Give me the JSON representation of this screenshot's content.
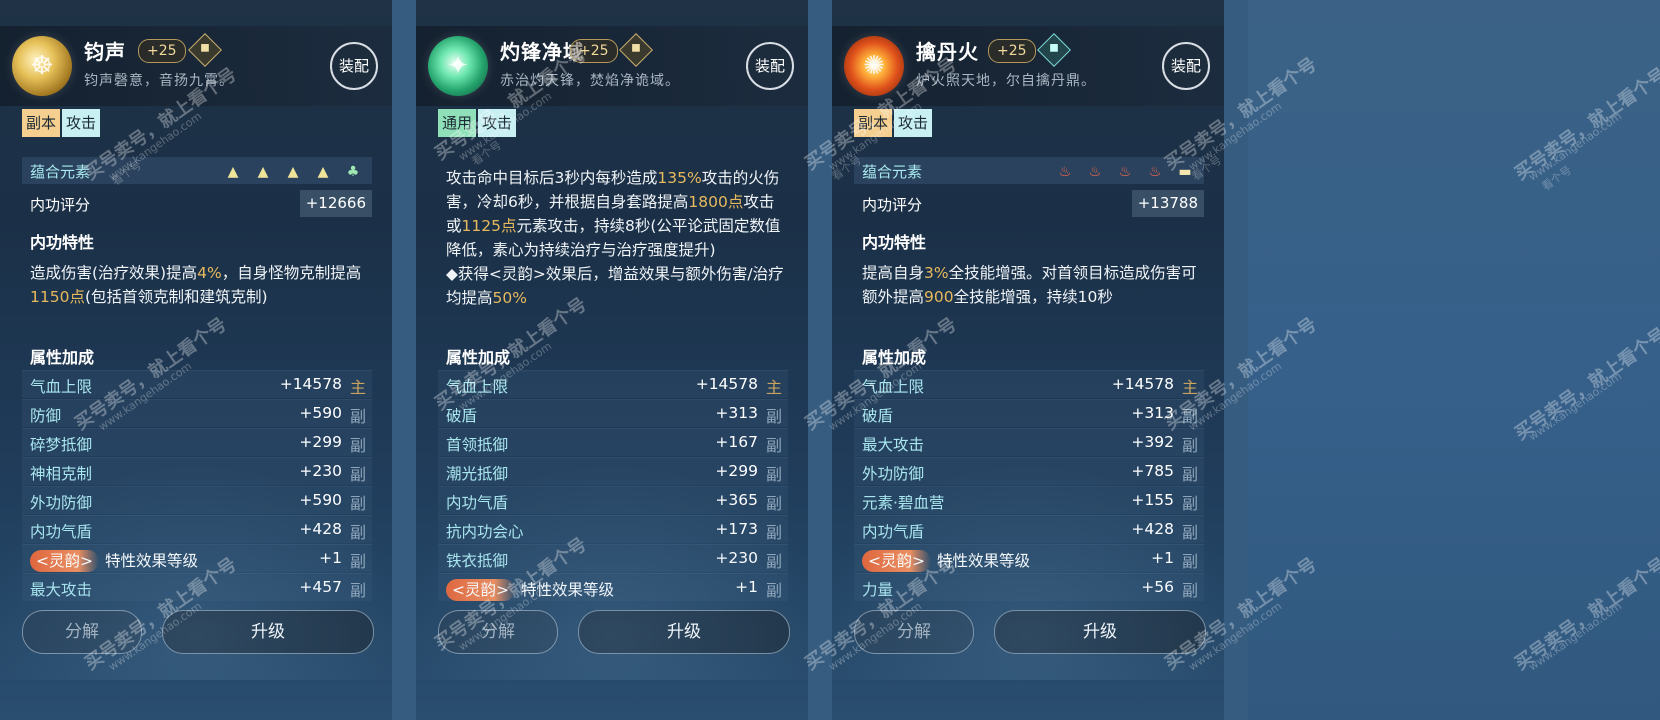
{
  "panels": [
    {
      "name": "钧声",
      "level": "+25",
      "desc": "钧声磬意，音扬九霄。",
      "equip": "装配",
      "tags": [
        "副本",
        "攻击"
      ],
      "element_label": "蕴合元素",
      "score_label": "内功评分",
      "score": "+12666",
      "trait_label": "内功特性",
      "trait_parts": [
        "造成伤害(治疗效果)提高",
        "4%",
        "，自身怪物克制提高",
        "1150点",
        "(包括首领克制和建筑克制)"
      ],
      "attr_label": "属性加成",
      "attrs": [
        {
          "label": "气血上限",
          "value": "+14578",
          "mark": "主"
        },
        {
          "label": "防御",
          "value": "+590",
          "mark": "副"
        },
        {
          "label": "碎梦抵御",
          "value": "+299",
          "mark": "副"
        },
        {
          "label": "神相克制",
          "value": "+230",
          "mark": "副"
        },
        {
          "label": "外功防御",
          "value": "+590",
          "mark": "副"
        },
        {
          "label": "内功气盾",
          "value": "+428",
          "mark": "副"
        },
        {
          "label": "特性效果等级",
          "badge": "<灵韵>",
          "value": "+1",
          "mark": "副"
        },
        {
          "label": "最大攻击",
          "value": "+457",
          "mark": "副"
        }
      ],
      "decompose": "分解",
      "upgrade": "升级"
    },
    {
      "name": "灼锋净域",
      "level": "+25",
      "desc": "赤治灼天锋，焚焰净诡域。",
      "equip": "装配",
      "tags": [
        "通用",
        "攻击"
      ],
      "trait_parts": [
        "攻击命中目标后3秒内每秒造成",
        "135%",
        "攻击的火伤害，冷却6秒，并根据自身套路提高",
        "1800点",
        "攻击或",
        "1125点",
        "元素攻击，持续8秒(公平论武固定数值降低，素心为持续治疗与治疗强度提升)"
      ],
      "trait_bullet": [
        "◆获得<灵韵>效果后，增益效果与额外伤害/治疗均提高",
        "50%"
      ],
      "attr_label": "属性加成",
      "attrs": [
        {
          "label": "气血上限",
          "value": "+14578",
          "mark": "主"
        },
        {
          "label": "破盾",
          "value": "+313",
          "mark": "副"
        },
        {
          "label": "首领抵御",
          "value": "+167",
          "mark": "副"
        },
        {
          "label": "潮光抵御",
          "value": "+299",
          "mark": "副"
        },
        {
          "label": "内功气盾",
          "value": "+365",
          "mark": "副"
        },
        {
          "label": "抗内功会心",
          "value": "+173",
          "mark": "副"
        },
        {
          "label": "铁衣抵御",
          "value": "+230",
          "mark": "副"
        },
        {
          "label": "特性效果等级",
          "badge": "<灵韵>",
          "value": "+1",
          "mark": "副"
        }
      ],
      "decompose": "分解",
      "upgrade": "升级"
    },
    {
      "name": "擒丹火",
      "level": "+25",
      "desc": "炉火照天地，尔自擒丹鼎。",
      "equip": "装配",
      "tags": [
        "副本",
        "攻击"
      ],
      "element_label": "蕴合元素",
      "score_label": "内功评分",
      "score": "+13788",
      "trait_label": "内功特性",
      "trait_parts": [
        "提高自身",
        "3%",
        "全技能增强。对首领目标造成伤害可额外提高",
        "900",
        "全技能增强，持续10秒"
      ],
      "attr_label": "属性加成",
      "attrs": [
        {
          "label": "气血上限",
          "value": "+14578",
          "mark": "主"
        },
        {
          "label": "破盾",
          "value": "+313",
          "mark": "副"
        },
        {
          "label": "最大攻击",
          "value": "+392",
          "mark": "副"
        },
        {
          "label": "外功防御",
          "value": "+785",
          "mark": "副"
        },
        {
          "label": "元素·碧血营",
          "value": "+155",
          "mark": "副"
        },
        {
          "label": "内功气盾",
          "value": "+428",
          "mark": "副"
        },
        {
          "label": "特性效果等级",
          "badge": "<灵韵>",
          "value": "+1",
          "mark": "副"
        },
        {
          "label": "力量",
          "value": "+56",
          "mark": "副"
        }
      ],
      "decompose": "分解",
      "upgrade": "升级"
    }
  ],
  "watermark": {
    "text": "买号卖号，就上看个号",
    "url": "www.kangehao.com",
    "badge": "看个号"
  },
  "colors": {
    "highlight": "#e8b95c",
    "attr_label": "#a9e6ee",
    "lingyun": "#e2653b"
  },
  "icons": {
    "element_1": "triangle-element-icon",
    "element_2": "leaf-element-icon",
    "element_3": "flame-element-icon",
    "element_4": "book-element-icon"
  }
}
